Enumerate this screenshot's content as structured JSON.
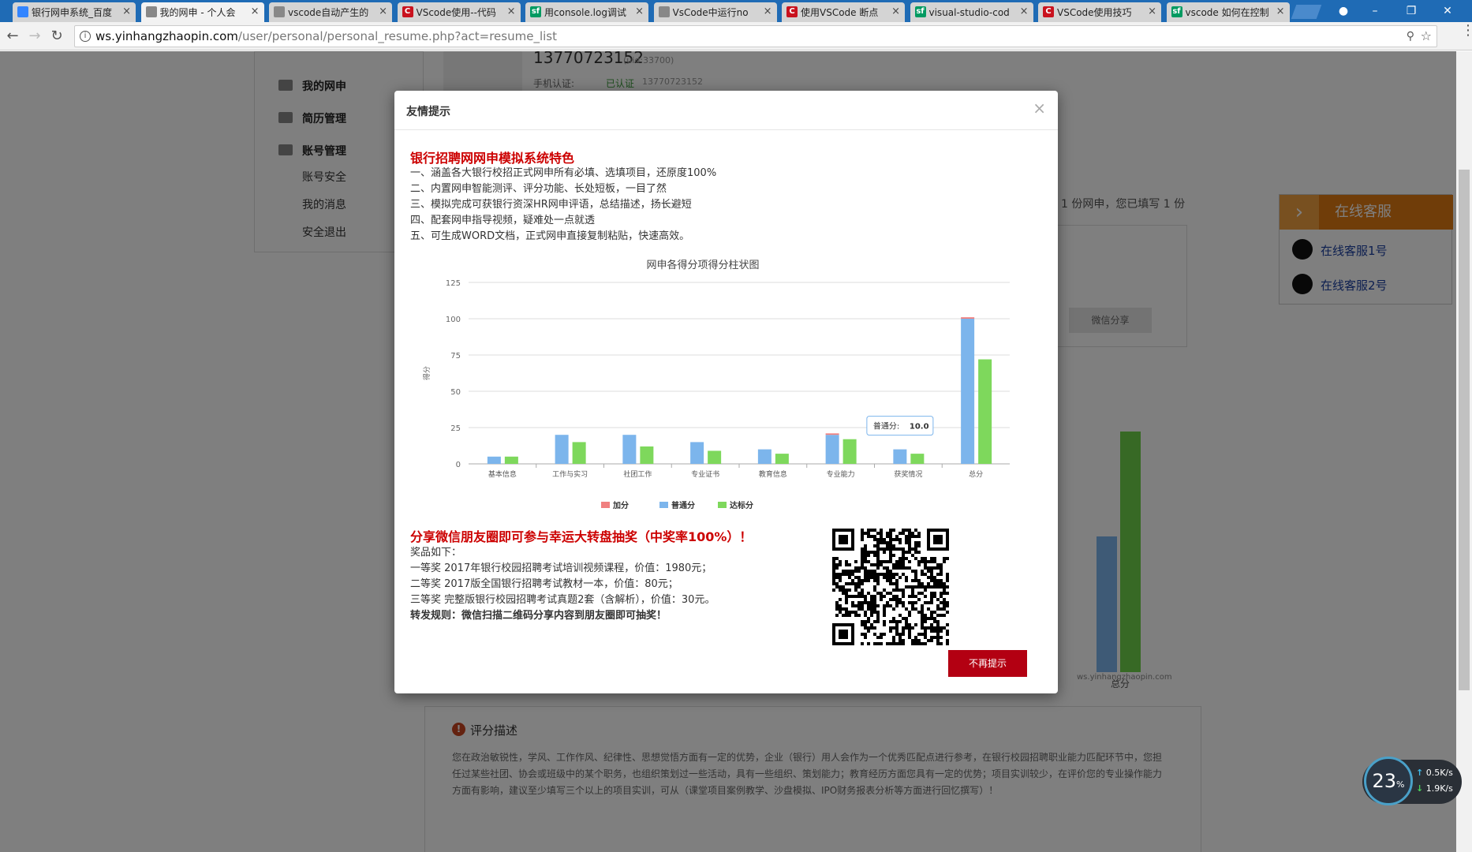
{
  "browser": {
    "tabs": [
      {
        "label": "银行网申系统_百度",
        "icon": "baidu-icon",
        "icon_text": "",
        "icon_color": "#3385ff"
      },
      {
        "label": "我的网申 - 个人会",
        "icon": "page-icon",
        "icon_text": "",
        "icon_color": "#888888"
      },
      {
        "label": "vscode自动产生的",
        "icon": "page-icon",
        "icon_text": "",
        "icon_color": "#888888"
      },
      {
        "label": "VScode使用--代码",
        "icon": "csdn-icon",
        "icon_text": "C",
        "icon_color": "#c9121e"
      },
      {
        "label": "用console.log调试",
        "icon": "sf-icon",
        "icon_text": "sf",
        "icon_color": "#009a61"
      },
      {
        "label": "VsCode中运行no",
        "icon": "page-icon",
        "icon_text": "",
        "icon_color": "#888888"
      },
      {
        "label": "使用VSCode 断点",
        "icon": "csdn-icon",
        "icon_text": "C",
        "icon_color": "#c9121e"
      },
      {
        "label": "visual-studio-cod",
        "icon": "sf-icon",
        "icon_text": "sf",
        "icon_color": "#009a61"
      },
      {
        "label": "VSCode使用技巧",
        "icon": "csdn-icon",
        "icon_text": "C",
        "icon_color": "#c9121e"
      },
      {
        "label": "vscode 如何在控制",
        "icon": "sf-icon",
        "icon_text": "sf",
        "icon_color": "#009a61"
      }
    ],
    "url_host": "ws.yinhangzhaopin.com",
    "url_path": "/user/personal/personal_resume.php?act=resume_list"
  },
  "page": {
    "sidebar": {
      "items": [
        {
          "label": "我的网申",
          "main": true
        },
        {
          "label": "简历管理",
          "main": true
        },
        {
          "label": "账号管理",
          "main": true
        },
        {
          "label": "账号安全",
          "main": false
        },
        {
          "label": "我的消息",
          "main": false
        },
        {
          "label": "安全退出",
          "main": false
        }
      ]
    },
    "phone": "13770723152",
    "phone_uid": "(uid:33700)",
    "phone_label": "手机认证:",
    "phone_verified": "已认证",
    "phone_number_small": "13770723152",
    "count_text": "1 份网申，您已填写 1 份",
    "weixin_share": "微信分享",
    "customer_service": {
      "title": "在线客服",
      "items": [
        "在线客服1号",
        "在线客服2号"
      ]
    },
    "bg_chart_label": "总分",
    "watermark": "ws.yinhangzhaopin.com",
    "description": {
      "title": "评分描述",
      "text": "您在政治敏锐性，学风、工作作风、纪律性、思想觉悟方面有一定的优势，企业（银行）用人会作为一个优秀匹配点进行参考，在银行校园招聘职业能力匹配环节中，您担任过某些社团、协会或班级中的某个职务，也组织策划过一些活动，具有一些组织、策划能力；教育经历方面您具有一定的优势；项目实训较少，在评价您的专业操作能力方面有影响，建议至少填写三个以上的项目实训，可从（课堂项目案例教学、沙盘模拟、IPO财务报表分析等方面进行回忆撰写）！"
    },
    "speed": {
      "percent": "23",
      "percent_unit": "%",
      "up": "0.5K/s",
      "down": "1.9K/s"
    }
  },
  "modal": {
    "title": "友情提示",
    "close": "×",
    "features_title": "银行招聘网网申模拟系统特色",
    "features": [
      "一、涵盖各大银行校招正式网申所有必填、选填项目，还原度100%",
      "二、内置网申智能测评、评分功能、长处短板，一目了然",
      "三、模拟完成可获银行资深HR网申评语，总结描述，扬长避短",
      "四、配套网申指导视频，疑难处一点就透",
      "五、可生成WORD文档，正式网申直接复制粘贴，快速高效。"
    ],
    "prize_title": "分享微信朋友圈即可参与幸运大转盘抽奖（中奖率100%）！",
    "prize_intro": "奖品如下：",
    "prizes": [
      "一等奖 2017年银行校园招聘考试培训视频课程，价值：1980元；",
      "二等奖 2017版全国银行招聘考试教材一本，价值：80元；",
      "三等奖 完整版银行校园招聘考试真题2套（含解析），价值：30元。"
    ],
    "prize_rule": "转发规则：微信扫描二维码分享内容到朋友圈即可抽奖！",
    "stop_button": "不再提示"
  },
  "chart_data": {
    "type": "bar",
    "title": "网申各得分项得分柱状图",
    "ylabel": "得分",
    "ylim": [
      0,
      125
    ],
    "yticks": [
      0,
      25,
      50,
      75,
      100,
      125
    ],
    "categories": [
      "基本信息",
      "工作与实习",
      "社团工作",
      "专业证书",
      "教育信息",
      "专业能力",
      "获奖情况",
      "总分"
    ],
    "series": [
      {
        "name": "加分",
        "color": "#f08080",
        "values": [
          0,
          0,
          0,
          0,
          0,
          1,
          0,
          1
        ]
      },
      {
        "name": "普通分",
        "color": "#7cb5ec",
        "values": [
          5,
          20,
          20,
          15,
          10,
          20,
          10,
          100
        ]
      },
      {
        "name": "达标分",
        "color": "#7ed85c",
        "values": [
          5,
          15,
          12,
          9,
          7,
          17,
          7,
          72
        ]
      }
    ],
    "tooltip": {
      "label": "普通分:",
      "value": "10.0"
    }
  }
}
